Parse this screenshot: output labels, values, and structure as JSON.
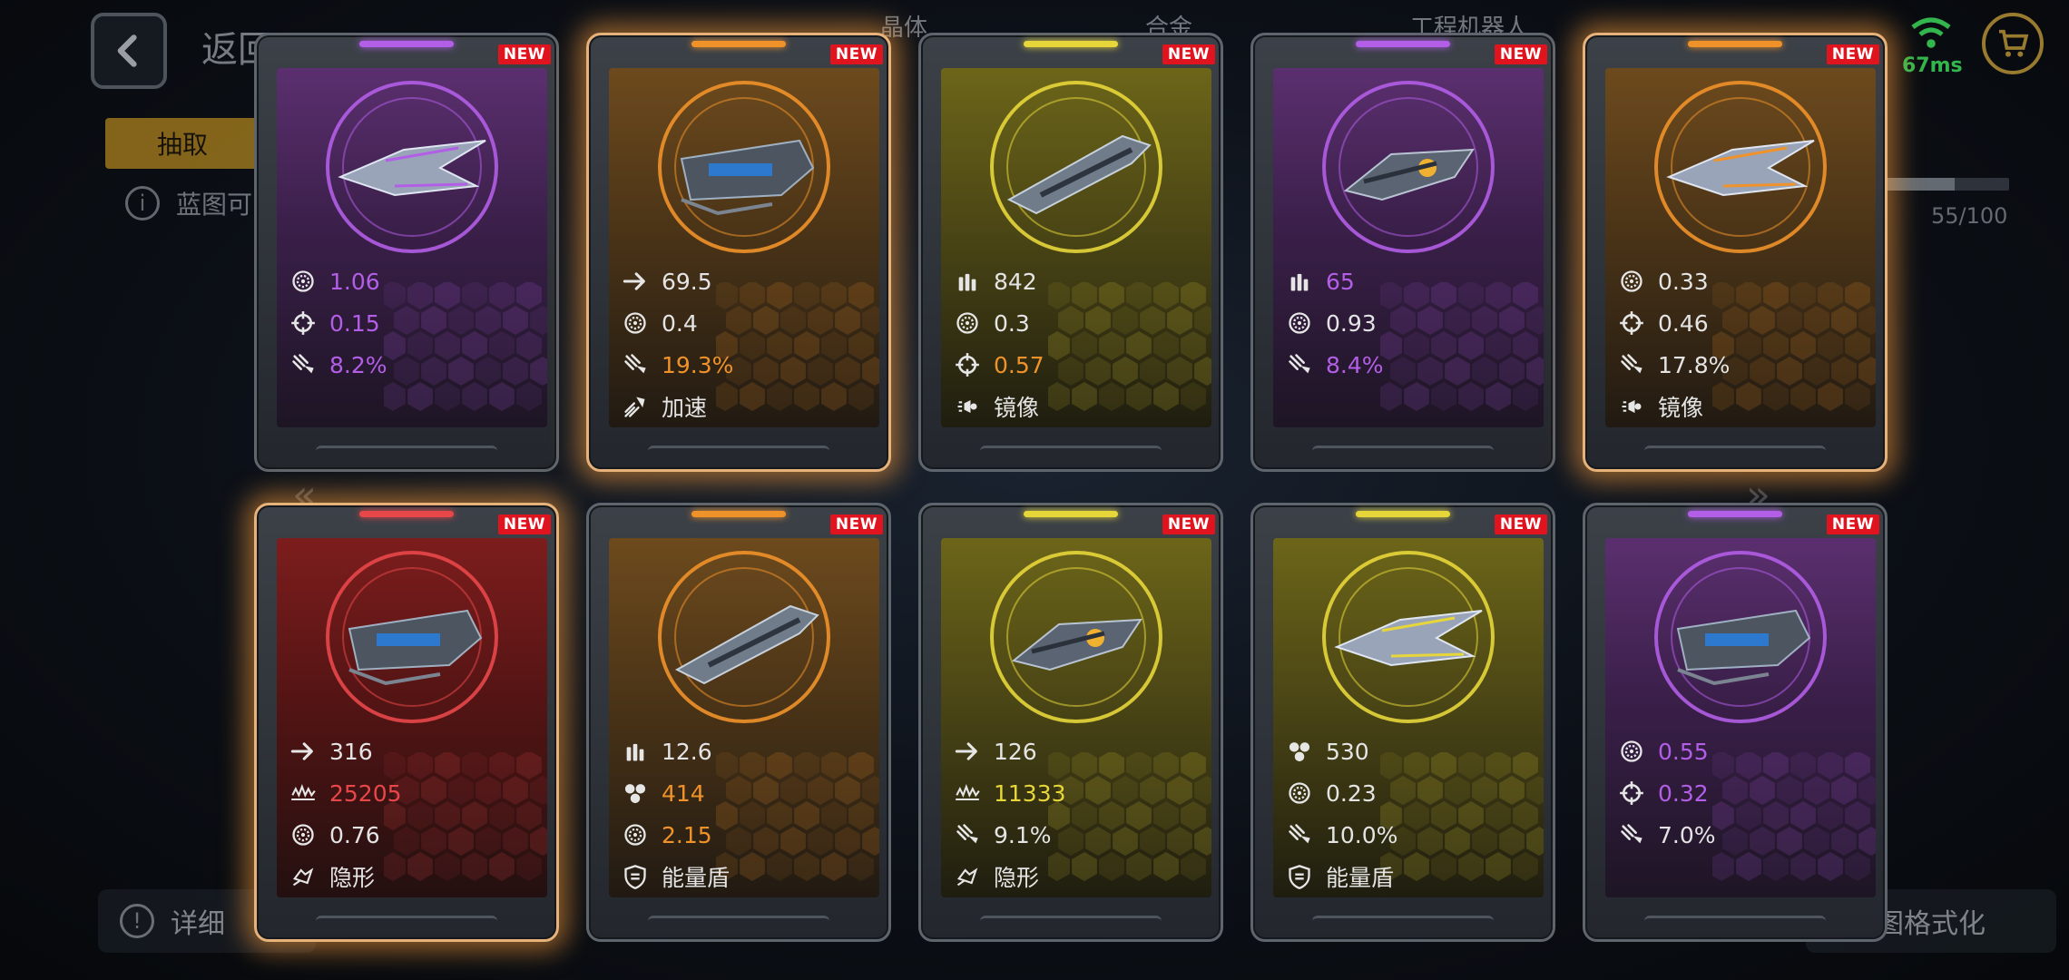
{
  "background": {
    "back_label": "返回",
    "top_tabs": [
      "晶体",
      "合金",
      "工程机器人"
    ],
    "draw_tab": "抽取",
    "info_text": "蓝图可",
    "progress_text": "55/100",
    "progress_fraction": 0.55,
    "ping": "67ms",
    "bottom_left": "详细",
    "bottom_right": "图格式化"
  },
  "colors": {
    "purple": "#b25ee6",
    "orange": "#f0922a",
    "yellow": "#e6d63a",
    "red": "#e8474a",
    "white": "#e4e4e4"
  },
  "cards": [
    {
      "rarity": "purple",
      "glow": false,
      "badge": "NEW",
      "stats": [
        {
          "icon": "fire-rate-icon",
          "value": "1.06",
          "color": "purple"
        },
        {
          "icon": "crosshair-icon",
          "value": "0.15",
          "color": "purple"
        },
        {
          "icon": "crit-icon",
          "value": "8.2%",
          "color": "purple"
        }
      ]
    },
    {
      "rarity": "orange",
      "glow": true,
      "badge": "NEW",
      "stats": [
        {
          "icon": "arrow-icon",
          "value": "69.5",
          "color": "white"
        },
        {
          "icon": "fire-rate-icon",
          "value": "0.4",
          "color": "white"
        },
        {
          "icon": "crit-icon",
          "value": "19.3%",
          "color": "orange"
        },
        {
          "icon": "boost-icon",
          "value": "加速",
          "color": "white"
        }
      ]
    },
    {
      "rarity": "yellow",
      "glow": false,
      "badge": "NEW",
      "stats": [
        {
          "icon": "ammo-icon",
          "value": "842",
          "color": "white"
        },
        {
          "icon": "fire-rate-icon",
          "value": "0.3",
          "color": "white"
        },
        {
          "icon": "crosshair-icon",
          "value": "0.57",
          "color": "orange"
        },
        {
          "icon": "mirror-icon",
          "value": "镜像",
          "color": "white"
        }
      ]
    },
    {
      "rarity": "purple",
      "glow": false,
      "badge": "NEW",
      "stats": [
        {
          "icon": "ammo-icon",
          "value": "65",
          "color": "purple"
        },
        {
          "icon": "fire-rate-icon",
          "value": "0.93",
          "color": "white"
        },
        {
          "icon": "crit-icon",
          "value": "8.4%",
          "color": "purple"
        }
      ]
    },
    {
      "rarity": "orange",
      "glow": true,
      "badge": "NEW",
      "stats": [
        {
          "icon": "fire-rate-icon",
          "value": "0.33",
          "color": "white"
        },
        {
          "icon": "crosshair-icon",
          "value": "0.46",
          "color": "white"
        },
        {
          "icon": "crit-icon",
          "value": "17.8%",
          "color": "white"
        },
        {
          "icon": "mirror-icon",
          "value": "镜像",
          "color": "white"
        }
      ]
    },
    {
      "rarity": "red",
      "glow": true,
      "badge": "NEW",
      "stats": [
        {
          "icon": "arrow-icon",
          "value": "316",
          "color": "white"
        },
        {
          "icon": "armor-icon",
          "value": "25205",
          "color": "red"
        },
        {
          "icon": "fire-rate-icon",
          "value": "0.76",
          "color": "white"
        },
        {
          "icon": "stealth-icon",
          "value": "隐形",
          "color": "white"
        }
      ]
    },
    {
      "rarity": "orange",
      "glow": false,
      "badge": "NEW",
      "stats": [
        {
          "icon": "ammo-icon",
          "value": "12.6",
          "color": "white"
        },
        {
          "icon": "cluster-icon",
          "value": "414",
          "color": "orange"
        },
        {
          "icon": "fire-rate-icon",
          "value": "2.15",
          "color": "orange"
        },
        {
          "icon": "shield-icon",
          "value": "能量盾",
          "color": "white"
        }
      ]
    },
    {
      "rarity": "yellow",
      "glow": false,
      "badge": "NEW",
      "stats": [
        {
          "icon": "arrow-icon",
          "value": "126",
          "color": "white"
        },
        {
          "icon": "armor-icon",
          "value": "11333",
          "color": "yellow"
        },
        {
          "icon": "crit-icon",
          "value": "9.1%",
          "color": "white"
        },
        {
          "icon": "stealth-icon",
          "value": "隐形",
          "color": "white"
        }
      ]
    },
    {
      "rarity": "yellow",
      "glow": false,
      "badge": "NEW",
      "stats": [
        {
          "icon": "cluster-icon",
          "value": "530",
          "color": "white"
        },
        {
          "icon": "fire-rate-icon",
          "value": "0.23",
          "color": "white"
        },
        {
          "icon": "crit-icon",
          "value": "10.0%",
          "color": "white"
        },
        {
          "icon": "shield-icon",
          "value": "能量盾",
          "color": "white"
        }
      ]
    },
    {
      "rarity": "purple",
      "glow": false,
      "badge": "NEW",
      "stats": [
        {
          "icon": "fire-rate-icon",
          "value": "0.55",
          "color": "purple"
        },
        {
          "icon": "crosshair-icon",
          "value": "0.32",
          "color": "purple"
        },
        {
          "icon": "crit-icon",
          "value": "7.0%",
          "color": "white"
        }
      ]
    }
  ]
}
